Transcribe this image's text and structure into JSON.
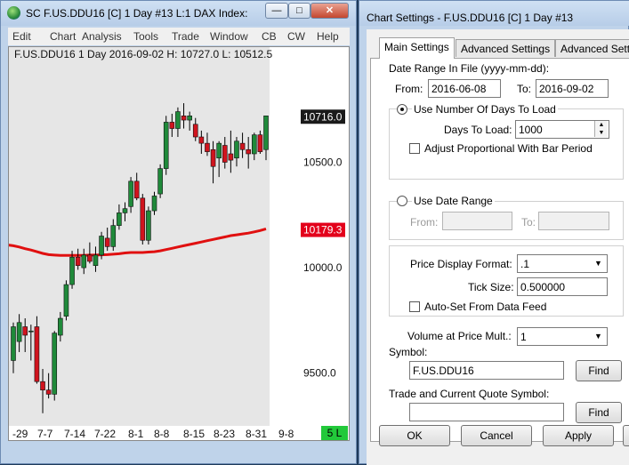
{
  "chart_window": {
    "title": "SC F.US.DDU16 [C]  1 Day   #13  L:1  DAX Index:",
    "menu": [
      "Edit",
      "Chart",
      "Analysis",
      "Tools",
      "Trade",
      "Window",
      "CB",
      "CW",
      "Help"
    ],
    "header": "F.US.DDU16 1 Day  2016-09-02 H: 10727.0 L: 10512.5",
    "status_badge": "5 L",
    "colors": {
      "up": "#1f8a3a",
      "down": "#d0141e",
      "ma": "#e01010",
      "price_tag_bg": "#1a1a1a",
      "ma_tag_bg": "#e3001b",
      "status_bg": "#22c93a"
    }
  },
  "chart_data": {
    "type": "candlestick",
    "symbol": "F.US.DDU16",
    "x_tick_labels": [
      "-29",
      "7-7",
      "7-14",
      "7-22",
      "8-1",
      "8-8",
      "8-15",
      "8-23",
      "8-31",
      "9-8"
    ],
    "y_tick_labels": [
      "10500.0",
      "10000.0",
      "9500.0"
    ],
    "y_ticks": [
      10500,
      10000,
      9500
    ],
    "ylim": [
      9250,
      10970
    ],
    "last_price_label": "10716.0",
    "last_price": 10716.0,
    "ma_label": "10179.3",
    "ma_value": 10179.3,
    "candles": [
      {
        "o": 9560,
        "h": 9740,
        "l": 9500,
        "c": 9720
      },
      {
        "o": 9650,
        "h": 9780,
        "l": 9600,
        "c": 9740
      },
      {
        "o": 9720,
        "h": 9760,
        "l": 9600,
        "c": 9680
      },
      {
        "o": 9700,
        "h": 9730,
        "l": 9560,
        "c": 9700
      },
      {
        "o": 9720,
        "h": 9770,
        "l": 9450,
        "c": 9460
      },
      {
        "o": 9460,
        "h": 9520,
        "l": 9310,
        "c": 9420
      },
      {
        "o": 9420,
        "h": 9500,
        "l": 9380,
        "c": 9400
      },
      {
        "o": 9400,
        "h": 9700,
        "l": 9370,
        "c": 9690
      },
      {
        "o": 9680,
        "h": 9790,
        "l": 9650,
        "c": 9760
      },
      {
        "o": 9770,
        "h": 9940,
        "l": 9750,
        "c": 9920
      },
      {
        "o": 9920,
        "h": 10080,
        "l": 9900,
        "c": 10050
      },
      {
        "o": 10050,
        "h": 10090,
        "l": 9990,
        "c": 10010
      },
      {
        "o": 10000,
        "h": 10090,
        "l": 9970,
        "c": 10060
      },
      {
        "o": 10060,
        "h": 10120,
        "l": 10020,
        "c": 10030
      },
      {
        "o": 10010,
        "h": 10100,
        "l": 9980,
        "c": 10060
      },
      {
        "o": 10060,
        "h": 10170,
        "l": 10040,
        "c": 10150
      },
      {
        "o": 10140,
        "h": 10190,
        "l": 10080,
        "c": 10100
      },
      {
        "o": 10100,
        "h": 10230,
        "l": 10080,
        "c": 10200
      },
      {
        "o": 10200,
        "h": 10300,
        "l": 10180,
        "c": 10260
      },
      {
        "o": 10260,
        "h": 10310,
        "l": 10220,
        "c": 10280
      },
      {
        "o": 10290,
        "h": 10430,
        "l": 10260,
        "c": 10410
      },
      {
        "o": 10410,
        "h": 10450,
        "l": 10320,
        "c": 10330
      },
      {
        "o": 10330,
        "h": 10350,
        "l": 10110,
        "c": 10130
      },
      {
        "o": 10130,
        "h": 10290,
        "l": 10110,
        "c": 10270
      },
      {
        "o": 10270,
        "h": 10360,
        "l": 10250,
        "c": 10340
      },
      {
        "o": 10350,
        "h": 10490,
        "l": 10330,
        "c": 10470
      },
      {
        "o": 10470,
        "h": 10720,
        "l": 10440,
        "c": 10690
      },
      {
        "o": 10690,
        "h": 10730,
        "l": 10620,
        "c": 10660
      },
      {
        "o": 10660,
        "h": 10760,
        "l": 10620,
        "c": 10740
      },
      {
        "o": 10720,
        "h": 10780,
        "l": 10660,
        "c": 10700
      },
      {
        "o": 10700,
        "h": 10740,
        "l": 10650,
        "c": 10720
      },
      {
        "o": 10680,
        "h": 10710,
        "l": 10600,
        "c": 10620
      },
      {
        "o": 10620,
        "h": 10650,
        "l": 10540,
        "c": 10590
      },
      {
        "o": 10590,
        "h": 10640,
        "l": 10530,
        "c": 10550
      },
      {
        "o": 10560,
        "h": 10600,
        "l": 10400,
        "c": 10480
      },
      {
        "o": 10520,
        "h": 10600,
        "l": 10430,
        "c": 10590
      },
      {
        "o": 10580,
        "h": 10620,
        "l": 10470,
        "c": 10500
      },
      {
        "o": 10540,
        "h": 10650,
        "l": 10450,
        "c": 10510
      },
      {
        "o": 10520,
        "h": 10620,
        "l": 10480,
        "c": 10600
      },
      {
        "o": 10590,
        "h": 10640,
        "l": 10520,
        "c": 10560
      },
      {
        "o": 10560,
        "h": 10620,
        "l": 10470,
        "c": 10540
      },
      {
        "o": 10540,
        "h": 10640,
        "l": 10510,
        "c": 10630
      },
      {
        "o": 10630,
        "h": 10650,
        "l": 10540,
        "c": 10550
      },
      {
        "o": 10560,
        "h": 10720,
        "l": 10510,
        "c": 10720
      }
    ],
    "moving_average": [
      10104,
      10098,
      10090,
      10084,
      10076,
      10068,
      10062,
      10060,
      10058,
      10058,
      10058,
      10058,
      10058,
      10060,
      10060,
      10061,
      10062,
      10064,
      10066,
      10070,
      10072,
      10072,
      10072,
      10074,
      10076,
      10080,
      10086,
      10092,
      10098,
      10104,
      10110,
      10116,
      10122,
      10128,
      10134,
      10140,
      10146,
      10152,
      10156,
      10160,
      10164,
      10170,
      10176,
      10184
    ]
  },
  "settings_window": {
    "title": "Chart Settings - F.US.DDU16 [C]  1 Day   #13",
    "tabs": [
      "Main Settings",
      "Advanced Settings",
      "Advanced Sett"
    ],
    "date_range_label": "Date Range In File (yyyy-mm-dd):",
    "from_label": "From:",
    "from_value": "2016-06-08",
    "to_label": "To:",
    "to_value": "2016-09-02",
    "use_days_label": "Use Number Of Days To Load",
    "days_to_load_label": "Days To Load:",
    "days_to_load_value": "1000",
    "adjust_label": "Adjust Proportional With Bar Period",
    "use_date_range_label": "Use Date Range",
    "dr_from_label": "From:",
    "dr_to_label": "To:",
    "price_format_label": "Price Display Format:",
    "price_format_value": ".1",
    "tick_size_label": "Tick Size:",
    "tick_size_value": "0.500000",
    "autoset_label": "Auto-Set From Data Feed",
    "vap_label": "Volume at Price Mult.:",
    "vap_value": "1",
    "symbol_label": "Symbol:",
    "symbol_value": "F.US.DDU16",
    "find1": "Find",
    "tq_label": "Trade and Current Quote Symbol:",
    "tq_value": "",
    "find2": "Find",
    "ok": "OK",
    "cancel": "Cancel",
    "apply": "Apply"
  }
}
